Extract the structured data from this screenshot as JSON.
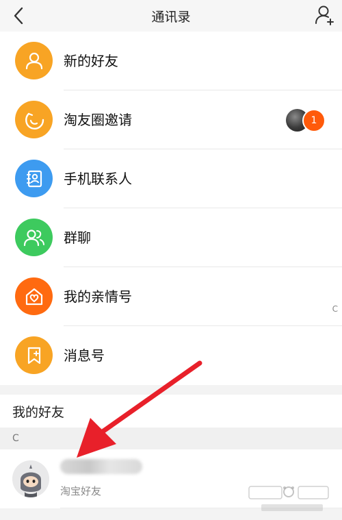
{
  "header": {
    "title": "通讯录"
  },
  "menu": {
    "items": [
      {
        "label": "新的好友",
        "icon": "new-friend-icon",
        "color": "#f8a424"
      },
      {
        "label": "淘友圈邀请",
        "icon": "friend-circle-icon",
        "color": "#f8a424",
        "badge": "1"
      },
      {
        "label": "手机联系人",
        "icon": "phone-contacts-icon",
        "color": "#3d9bf0"
      },
      {
        "label": "群聊",
        "icon": "group-chat-icon",
        "color": "#3dca5e"
      },
      {
        "label": "我的亲情号",
        "icon": "family-icon",
        "color": "#ff6a10"
      },
      {
        "label": "消息号",
        "icon": "message-account-icon",
        "color": "#f8a424"
      }
    ]
  },
  "friends_section": {
    "title": "我的好友",
    "index_letter": "C",
    "side_index_letter": "C",
    "friend": {
      "subtitle": "淘宝好友"
    }
  },
  "colors": {
    "accent": "#ff5a0a",
    "arrow": "#e8202a"
  }
}
